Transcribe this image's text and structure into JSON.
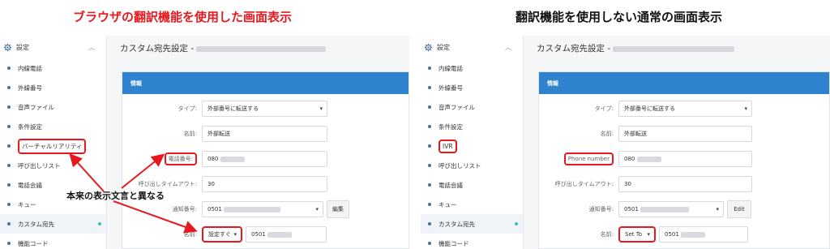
{
  "captions": {
    "left": "ブラウザの翻訳機能を使用した画面表示",
    "right": "翻訳機能を使用しない通常の画面表示"
  },
  "annotation": "本来の表示文言と異なる",
  "left": {
    "sidebar_header": "設定",
    "sidebar_items": [
      "内線電話",
      "外線番号",
      "音声ファイル",
      "条件設定",
      "バーチャルリアリティ",
      "呼び出しリスト",
      "電話会議",
      "キュー",
      "カスタム宛先",
      "機能コード"
    ],
    "page_title": "カスタム宛先設定 -",
    "card_title": "情報",
    "type_label": "タイプ:",
    "type_value": "外部番号に転送する",
    "name_label": "名前:",
    "name_value": "外部転送",
    "phone_label": "電話番号:",
    "phone_value": "080",
    "timeout_label": "呼び出しタイムアウト:",
    "timeout_value": "30",
    "notify_label": "通知番号:",
    "notify_value": "0501",
    "edit_button": "編集",
    "name2_label": "名前:",
    "name2_select": "設定すぐ",
    "name2_value": "0501"
  },
  "right": {
    "sidebar_header": "設定",
    "sidebar_items": [
      "内線電話",
      "外線番号",
      "音声ファイル",
      "条件設定",
      "IVR",
      "呼び出しリスト",
      "電話会議",
      "キュー",
      "カスタム宛先",
      "機能コード"
    ],
    "page_title": "カスタム宛先設定 -",
    "card_title": "情報",
    "type_label": "タイプ:",
    "type_value": "外部番号に転送する",
    "name_label": "名前:",
    "name_value": "外部転送",
    "phone_label": "Phone number",
    "phone_value": "080",
    "timeout_label": "呼び出しタイムアウト:",
    "timeout_value": "30",
    "notify_label": "通知番号:",
    "notify_value": "0501",
    "edit_button": "Edit",
    "name2_label": "名前:",
    "name2_select": "Set To",
    "name2_value": "0501"
  },
  "colors": {
    "caption_red": "#e8191e",
    "card_header": "#2f82cd",
    "bullet": "#4a6fa5",
    "active_indicator": "#3cc0b4"
  },
  "icons": {
    "settings": "gear-icon",
    "collapse": "chevron-up-icon",
    "select": "chevron-down-icon"
  }
}
